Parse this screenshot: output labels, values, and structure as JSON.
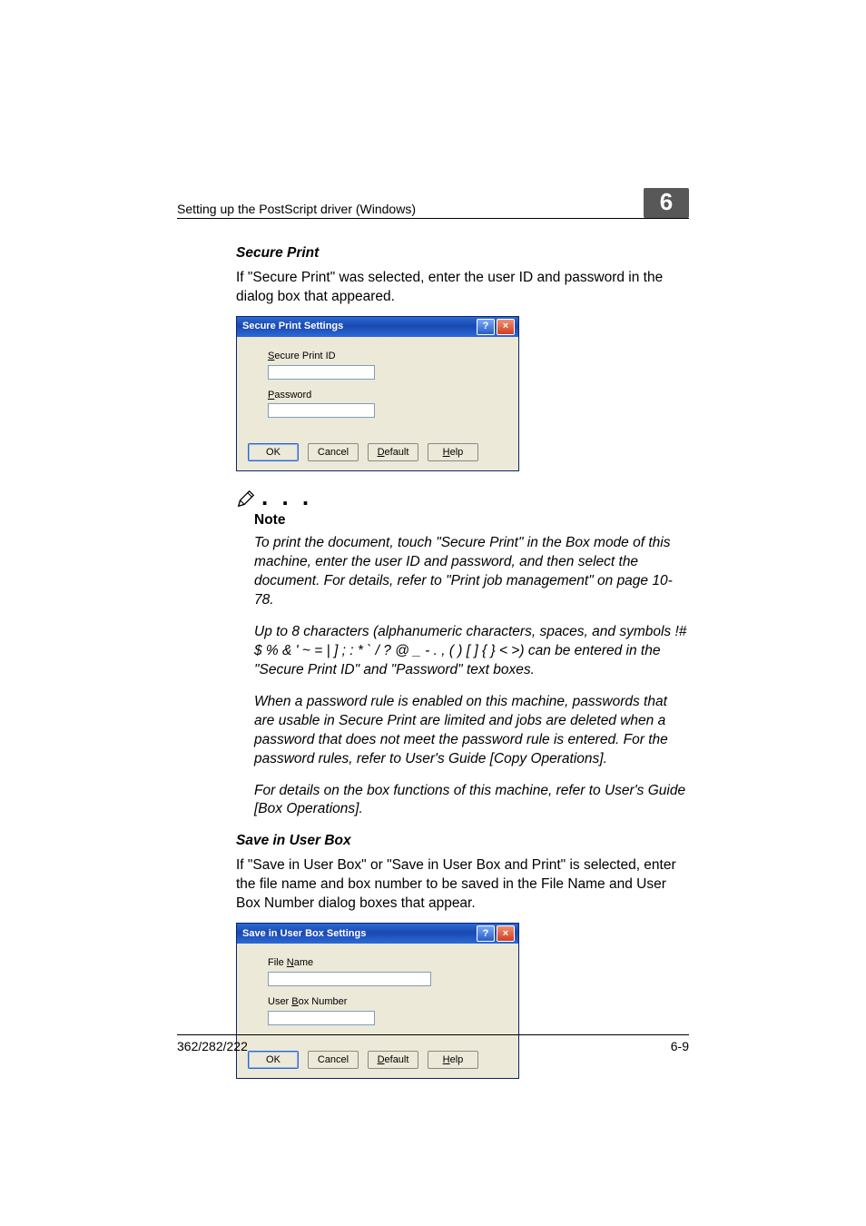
{
  "header": {
    "running_title": "Setting up the PostScript driver (Windows)",
    "chapter_number": "6"
  },
  "section1": {
    "title": "Secure Print",
    "intro": "If \"Secure Print\" was selected, enter the user ID and password in the dialog box that appeared."
  },
  "dialog1": {
    "title": "Secure Print Settings",
    "field1_label_pre": "S",
    "field1_label_rest": "ecure Print ID",
    "field2_label_pre": "P",
    "field2_label_rest": "assword",
    "ok": "OK",
    "cancel": "Cancel",
    "default_pre": "D",
    "default_rest": "efault",
    "help_pre": "H",
    "help_rest": "elp",
    "help_glyph": "?",
    "close_glyph": "×"
  },
  "note": {
    "symbol": ". . .",
    "label": "Note",
    "p1": "To print the document, touch \"Secure Print\" in the Box mode of this machine, enter the user ID and password, and then select the document. For details, refer to \"Print job management\" on page 10-78.",
    "p2": "Up to 8 characters (alphanumeric characters, spaces, and symbols !# $ % & ' ~ = | ] ; : * ` / ? @ _ - . , ( ) [ ] { } < >) can be entered in the \"Secure Print ID\" and \"Password\" text boxes.",
    "p3": "When a password rule is enabled on this machine, passwords that are usable in Secure Print are limited and jobs are deleted when a password that does not meet the password rule is entered. For the password rules, refer to User's Guide [Copy Operations].",
    "p4": "For details on the box functions of this machine, refer to User's Guide [Box Operations]."
  },
  "section2": {
    "title": "Save in User Box",
    "intro": "If \"Save in User Box\" or \"Save in User Box and Print\" is selected, enter the file name and box number to be saved in the File Name and User Box Number dialog boxes that appear."
  },
  "dialog2": {
    "title": "Save in User Box Settings",
    "field1_label_pre": "File ",
    "field1_label_ul": "N",
    "field1_label_post": "ame",
    "field2_label_pre": "User ",
    "field2_label_ul": "B",
    "field2_label_post": "ox Number",
    "ok": "OK",
    "cancel": "Cancel",
    "default_pre": "D",
    "default_rest": "efault",
    "help_pre": "H",
    "help_rest": "elp",
    "help_glyph": "?",
    "close_glyph": "×"
  },
  "footer": {
    "left": "362/282/222",
    "right": "6-9"
  }
}
